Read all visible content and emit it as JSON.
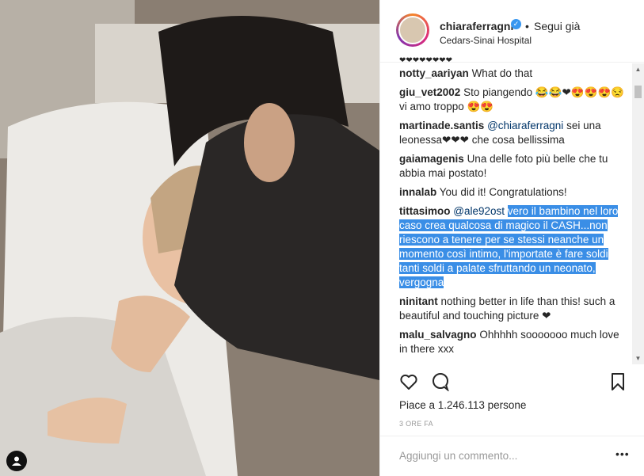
{
  "post": {
    "username": "chiaraferragni",
    "verified_icon": "verified-badge-icon",
    "separator": "•",
    "follow_status": "Segui già",
    "location": "Cedars-Sinai Hospital"
  },
  "comments": [
    {
      "user": "notty_aariyan",
      "text": "What do that"
    },
    {
      "user": "giu_vet2002",
      "text": "Sto piangendo 😂😂❤😍😍😍😒vi amo troppo 😍😍"
    },
    {
      "user": "martinade.santis",
      "mention": "@chiaraferragni",
      "text": "sei una leonessa❤❤❤ che cosa bellissima"
    },
    {
      "user": "gaiamagenis",
      "text": "Una delle foto più belle che tu abbia mai postato!"
    },
    {
      "user": "innalab",
      "text": "You did it! Congratulations!"
    },
    {
      "user": "tittasimoo",
      "mention": "@ale92ost",
      "text": "vero il bambino nel loro caso crea qualcosa di magico il CASH...non riescono a tenere per se stessi neanche un momento così intimo, l'importate è fare soldi tanti soldi a palate sfruttando un neonato, vergogna",
      "highlighted": true
    },
    {
      "user": "ninitant",
      "text": "nothing better in life than this! such a beautiful and touching picture ❤"
    },
    {
      "user": "malu_salvagno",
      "text": "Ohhhhh sooooooo much love in there xxx"
    }
  ],
  "actions": {
    "like_icon": "heart-icon",
    "comment_icon": "comment-icon",
    "save_icon": "bookmark-icon"
  },
  "likes_text": "Piace a 1.246.113 persone",
  "time_text": "3 ORE FA",
  "add_comment_placeholder": "Aggiungi un commento...",
  "more_options": "•••"
}
